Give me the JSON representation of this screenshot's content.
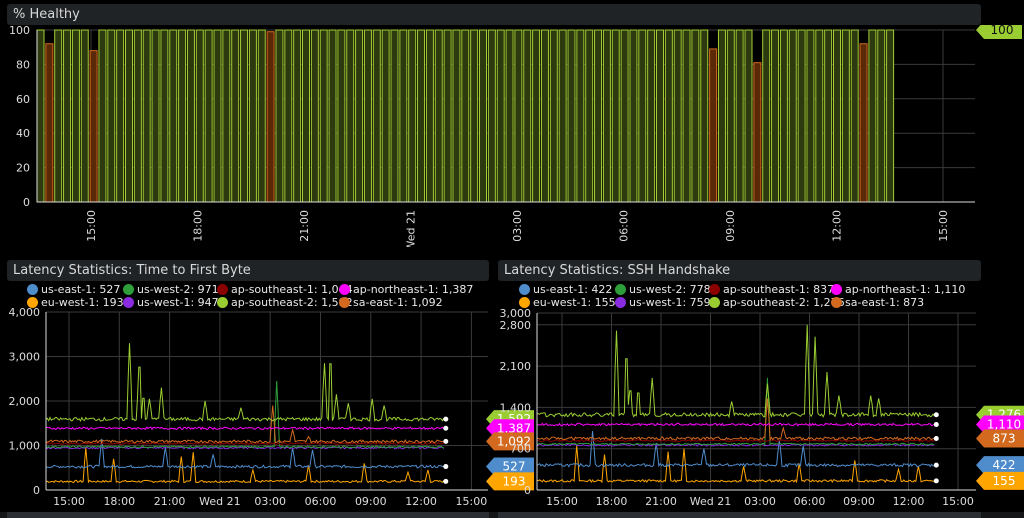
{
  "chart_data": [
    {
      "type": "bar",
      "title": "% Healthy",
      "ylim": [
        0,
        100
      ],
      "y_ticks": [
        "0",
        "20",
        "40",
        "60",
        "80",
        "100"
      ],
      "x_ticks": [
        "15:00",
        "18:00",
        "21:00",
        "Wed 21",
        "03:00",
        "06:00",
        "09:00",
        "12:00",
        "15:00"
      ],
      "grid": true,
      "values": [
        100,
        92,
        100,
        100,
        100,
        100,
        88,
        100,
        100,
        100,
        100,
        100,
        100,
        100,
        100,
        100,
        100,
        100,
        100,
        100,
        100,
        100,
        100,
        100,
        100,
        100,
        99,
        100,
        100,
        100,
        100,
        100,
        100,
        100,
        100,
        100,
        100,
        100,
        100,
        100,
        100,
        100,
        100,
        100,
        100,
        100,
        100,
        100,
        100,
        100,
        100,
        100,
        100,
        100,
        100,
        100,
        100,
        100,
        100,
        100,
        100,
        100,
        100,
        100,
        100,
        100,
        100,
        100,
        100,
        100,
        100,
        100,
        100,
        100,
        100,
        100,
        89,
        100,
        100,
        100,
        100,
        81,
        100,
        100,
        100,
        100,
        100,
        100,
        100,
        100,
        100,
        100,
        100,
        92,
        100,
        100,
        100
      ],
      "colors": {
        "healthy": "#a4cc34",
        "unhealthy": "#d2691e"
      },
      "current_value": "100"
    },
    {
      "type": "line",
      "title": "Latency Statistics: Time to First Byte",
      "ylim": [
        0,
        4000
      ],
      "y_ticks": [
        "0",
        "1,000",
        "2,000",
        "3,000",
        "4,000"
      ],
      "x_ticks": [
        "15:00",
        "18:00",
        "21:00",
        "Wed 21",
        "03:00",
        "06:00",
        "09:00",
        "12:00",
        "15:00"
      ],
      "grid": true,
      "legend_rows": [
        [
          {
            "label": "us-east-1: 527",
            "color": "#4f8ccc"
          },
          {
            "label": "us-west-2: 971",
            "color": "#2e9e3a"
          },
          {
            "label": "ap-southeast-1: 1,044",
            "color": "#8b0000"
          },
          {
            "label": "ap-northeast-1: 1,387",
            "color": "#ff00ff"
          }
        ],
        [
          {
            "label": "eu-west-1: 193",
            "color": "#ffa500"
          },
          {
            "label": "us-west-1: 947",
            "color": "#8a2be2"
          },
          {
            "label": "ap-southeast-2: 1,592",
            "color": "#9acd32"
          },
          {
            "label": "sa-east-1: 1,092",
            "color": "#d2691e"
          }
        ]
      ],
      "series": [
        {
          "name": "ap-southeast-2",
          "color": "#9acd32",
          "base": 1592,
          "noise": 40,
          "spikes": [
            [
              0.21,
              3300
            ],
            [
              0.235,
              3100
            ],
            [
              0.245,
              2200
            ],
            [
              0.26,
              2050
            ],
            [
              0.29,
              2300
            ],
            [
              0.4,
              2000
            ],
            [
              0.49,
              1850
            ],
            [
              0.7,
              2850
            ],
            [
              0.715,
              3200
            ],
            [
              0.73,
              2150
            ],
            [
              0.76,
              1950
            ],
            [
              0.82,
              2050
            ],
            [
              0.85,
              1900
            ]
          ]
        },
        {
          "name": "ap-northeast-1",
          "color": "#ff00ff",
          "base": 1387,
          "noise": 25,
          "spikes": []
        },
        {
          "name": "sa-east-1",
          "color": "#d2691e",
          "base": 1092,
          "noise": 30,
          "spikes": [
            [
              0.57,
              1900
            ],
            [
              0.62,
              1350
            ],
            [
              0.66,
              1200
            ]
          ]
        },
        {
          "name": "ap-southeast-1",
          "color": "#8b0000",
          "base": 1044,
          "noise": 20,
          "spikes": []
        },
        {
          "name": "us-west-2",
          "color": "#2e9e3a",
          "base": 971,
          "noise": 20,
          "spikes": [
            [
              0.58,
              2450
            ]
          ]
        },
        {
          "name": "us-west-1",
          "color": "#8a2be2",
          "base": 947,
          "noise": 20,
          "spikes": []
        },
        {
          "name": "us-east-1",
          "color": "#4f8ccc",
          "base": 527,
          "noise": 30,
          "spikes": [
            [
              0.14,
              1150
            ],
            [
              0.3,
              950
            ],
            [
              0.42,
              800
            ],
            [
              0.62,
              950
            ],
            [
              0.67,
              900
            ]
          ]
        },
        {
          "name": "eu-west-1",
          "color": "#ffa500",
          "base": 193,
          "noise": 25,
          "spikes": [
            [
              0.1,
              950
            ],
            [
              0.17,
              700
            ],
            [
              0.34,
              750
            ],
            [
              0.37,
              850
            ],
            [
              0.52,
              450
            ],
            [
              0.66,
              550
            ],
            [
              0.8,
              600
            ],
            [
              0.91,
              400
            ],
            [
              0.96,
              450
            ]
          ]
        }
      ],
      "last_values": [
        {
          "label": "1,592",
          "color": "#9acd32",
          "value": 1592
        },
        {
          "label": "1,387",
          "color": "#ff00ff",
          "value": 1387
        },
        {
          "label": "1,092",
          "color": "#d2691e",
          "value": 1092
        },
        {
          "label": "527",
          "color": "#4f8ccc",
          "value": 527
        },
        {
          "label": "193",
          "color": "#ffa500",
          "value": 193
        }
      ]
    },
    {
      "type": "line",
      "title": "Latency Statistics: SSH Handshake",
      "ylim": [
        0,
        3000
      ],
      "y_ticks": [
        "0",
        "700",
        "1,400",
        "2,100",
        "2,800",
        "3,000"
      ],
      "y_tick_values": [
        0,
        700,
        1400,
        2100,
        2800,
        3000
      ],
      "x_ticks": [
        "15:00",
        "18:00",
        "21:00",
        "Wed 21",
        "03:00",
        "06:00",
        "09:00",
        "12:00",
        "15:00"
      ],
      "grid": true,
      "legend_rows": [
        [
          {
            "label": "us-east-1: 422",
            "color": "#4f8ccc"
          },
          {
            "label": "us-west-2: 778",
            "color": "#2e9e3a"
          },
          {
            "label": "ap-southeast-1: 837",
            "color": "#8b0000"
          },
          {
            "label": "ap-northeast-1: 1,110",
            "color": "#ff00ff"
          }
        ],
        [
          {
            "label": "eu-west-1: 155",
            "color": "#ffa500"
          },
          {
            "label": "us-west-1: 759",
            "color": "#8a2be2"
          },
          {
            "label": "ap-southeast-2: 1,276",
            "color": "#9acd32"
          },
          {
            "label": "sa-east-1: 873",
            "color": "#d2691e"
          }
        ]
      ],
      "series": [
        {
          "name": "ap-southeast-2",
          "color": "#9acd32",
          "base": 1276,
          "noise": 35,
          "spikes": [
            [
              0.2,
              2700
            ],
            [
              0.225,
              2500
            ],
            [
              0.235,
              1800
            ],
            [
              0.255,
              1750
            ],
            [
              0.29,
              1900
            ],
            [
              0.49,
              1500
            ],
            [
              0.58,
              1800
            ],
            [
              0.68,
              2800
            ],
            [
              0.7,
              2600
            ],
            [
              0.73,
              2000
            ],
            [
              0.76,
              1600
            ],
            [
              0.84,
              1600
            ],
            [
              0.86,
              1550
            ]
          ]
        },
        {
          "name": "ap-northeast-1",
          "color": "#ff00ff",
          "base": 1110,
          "noise": 20,
          "spikes": []
        },
        {
          "name": "sa-east-1",
          "color": "#d2691e",
          "base": 873,
          "noise": 25,
          "spikes": [
            [
              0.58,
              1550
            ],
            [
              0.62,
              1050
            ]
          ]
        },
        {
          "name": "ap-southeast-1",
          "color": "#8b0000",
          "base": 837,
          "noise": 15,
          "spikes": []
        },
        {
          "name": "us-west-2",
          "color": "#2e9e3a",
          "base": 778,
          "noise": 15,
          "spikes": [
            [
              0.58,
              1900
            ]
          ]
        },
        {
          "name": "us-west-1",
          "color": "#8a2be2",
          "base": 759,
          "noise": 15,
          "spikes": []
        },
        {
          "name": "us-east-1",
          "color": "#4f8ccc",
          "base": 422,
          "noise": 25,
          "spikes": [
            [
              0.14,
              1000
            ],
            [
              0.3,
              800
            ],
            [
              0.42,
              700
            ],
            [
              0.61,
              850
            ],
            [
              0.67,
              750
            ]
          ]
        },
        {
          "name": "eu-west-1",
          "color": "#ffa500",
          "base": 155,
          "noise": 20,
          "spikes": [
            [
              0.1,
              750
            ],
            [
              0.17,
              600
            ],
            [
              0.33,
              650
            ],
            [
              0.37,
              700
            ],
            [
              0.52,
              400
            ],
            [
              0.66,
              450
            ],
            [
              0.8,
              500
            ],
            [
              0.91,
              350
            ],
            [
              0.96,
              400
            ]
          ]
        }
      ],
      "last_values": [
        {
          "label": "1,276",
          "color": "#9acd32",
          "value": 1276
        },
        {
          "label": "1,110",
          "color": "#ff00ff",
          "value": 1110
        },
        {
          "label": "873",
          "color": "#d2691e",
          "value": 873
        },
        {
          "label": "422",
          "color": "#4f8ccc",
          "value": 422
        },
        {
          "label": "155",
          "color": "#ffa500",
          "value": 155
        }
      ]
    }
  ]
}
